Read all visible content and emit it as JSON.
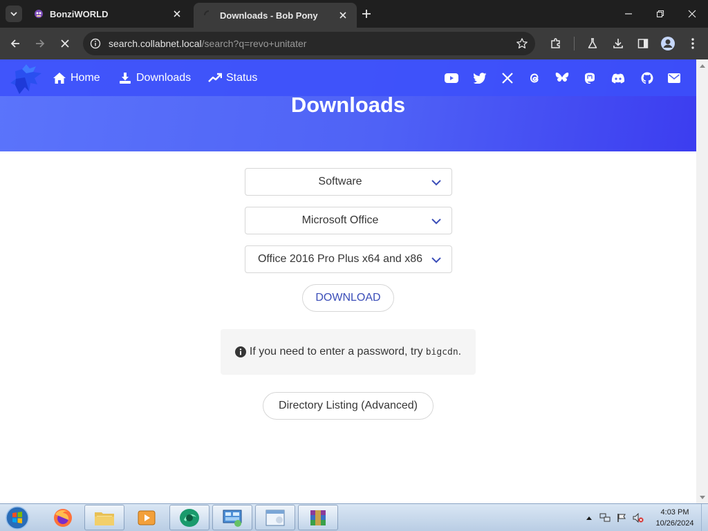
{
  "browser": {
    "tabs": [
      {
        "title": "BonziWORLD",
        "active": false
      },
      {
        "title": "Downloads - Bob Pony",
        "active": true
      }
    ],
    "address": {
      "host": "search.collabnet.local",
      "path": "/search?q=revo+unitater"
    }
  },
  "site": {
    "nav": {
      "home": "Home",
      "downloads": "Downloads",
      "status": "Status"
    },
    "social_icons": [
      "youtube-icon",
      "twitter-icon",
      "x-icon",
      "threads-icon",
      "bluesky-icon",
      "mastodon-icon",
      "discord-icon",
      "github-icon",
      "email-icon"
    ],
    "hero_title": "Downloads",
    "selects": {
      "category": "Software",
      "product": "Microsoft Office",
      "version": "Office 2016 Pro Plus x64 and x86"
    },
    "download_button": "DOWNLOAD",
    "notice": {
      "text": "If you need to enter a password, try",
      "code": "bigcdn",
      "suffix": "."
    },
    "directory_button": "Directory Listing (Advanced)"
  },
  "taskbar": {
    "clock": {
      "time": "4:03 PM",
      "date": "10/26/2024"
    }
  },
  "colors": {
    "brand_blue": "#4f62f6",
    "button_text": "#3a4db8",
    "tab_bg": "#1f1f1f",
    "toolbar_bg": "#3b3b3b"
  }
}
